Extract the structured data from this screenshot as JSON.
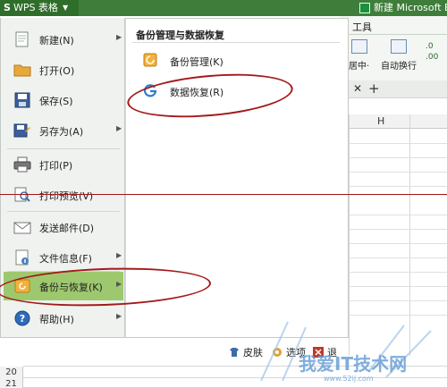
{
  "app": {
    "menu_button_label": "WPS 表格",
    "window_title": "新建 Microsoft Exce"
  },
  "ribbon": {
    "tools_tab": "工具",
    "merge_label": "居中·",
    "wrap_label": "自动换行",
    "number_format": ".0 .00"
  },
  "sheet": {
    "column_h": "H",
    "row_20": "20",
    "row_21": "21"
  },
  "menu": {
    "items": [
      {
        "label": "新建(N)",
        "icon": "new-icon"
      },
      {
        "label": "打开(O)",
        "icon": "open-folder-icon"
      },
      {
        "label": "保存(S)",
        "icon": "save-icon"
      },
      {
        "label": "另存为(A)",
        "icon": "save-as-icon"
      },
      {
        "label": "打印(P)",
        "icon": "print-icon"
      },
      {
        "label": "打印预览(V)",
        "icon": "print-preview-icon"
      },
      {
        "label": "发送邮件(D)",
        "icon": "mail-icon"
      },
      {
        "label": "文件信息(F)",
        "icon": "file-info-icon"
      },
      {
        "label": "备份与恢复(K)",
        "icon": "backup-icon"
      },
      {
        "label": "帮助(H)",
        "icon": "help-icon"
      }
    ],
    "submenu_title": "备份管理与数据恢复",
    "submenu_items": [
      {
        "label": "备份管理(K)",
        "icon": "backup-manage-icon"
      },
      {
        "label": "数据恢复(R)",
        "icon": "data-recovery-icon"
      }
    ],
    "footer": {
      "skin": "皮肤",
      "options": "选项",
      "exit": "退"
    }
  },
  "watermark": {
    "text": "我爱IT技术网",
    "url": "www.52ij.com"
  },
  "colors": {
    "title_bar": "#3f7d3a",
    "menu_active": "#9ec86e",
    "annotation": "#a31a1a"
  }
}
